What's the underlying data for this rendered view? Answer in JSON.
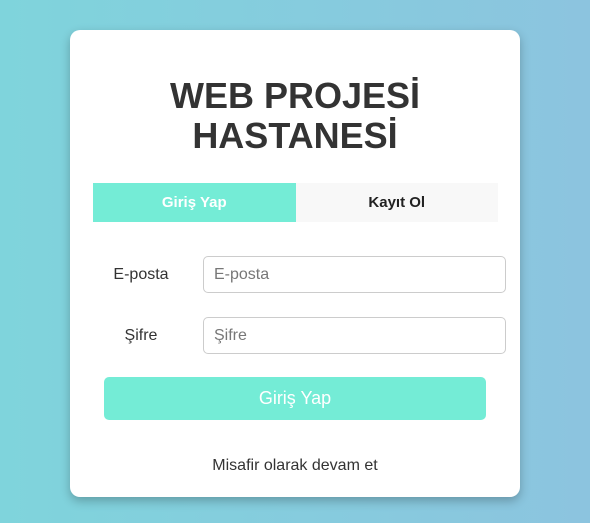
{
  "header": {
    "title_line1": "WEB PROJESİ",
    "title_line2": "HASTANESİ"
  },
  "tabs": [
    {
      "label": "Giriş Yap",
      "active": true
    },
    {
      "label": "Kayıt Ol",
      "active": false
    }
  ],
  "form": {
    "email": {
      "label": "E-posta",
      "placeholder": "E-posta",
      "value": ""
    },
    "password": {
      "label": "Şifre",
      "placeholder": "Şifre",
      "value": ""
    },
    "submit_label": "Giriş Yap"
  },
  "guest_link": "Misafir olarak devam et",
  "colors": {
    "accent": "#74ecd6",
    "text": "#333333"
  }
}
